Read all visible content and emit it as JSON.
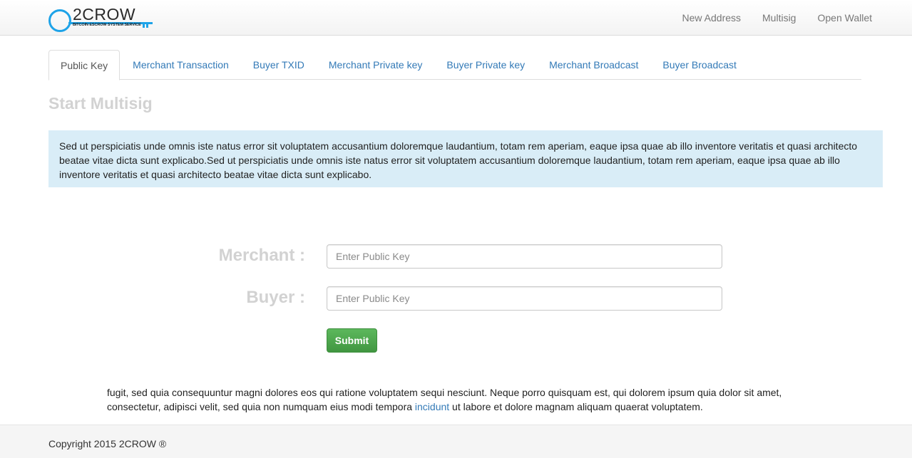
{
  "brand": {
    "name": "2CROW",
    "tagline": "BITCOIN ESCROW SYSTEM SERVICE",
    "accent_color": "#1ea3e8"
  },
  "nav": {
    "links": [
      "New Address",
      "Multisig",
      "Open Wallet"
    ]
  },
  "tabs": {
    "items": [
      "Public Key",
      "Merchant Transaction",
      "Buyer TXID",
      "Merchant Private key",
      "Buyer Private key",
      "Merchant Broadcast",
      "Buyer Broadcast"
    ],
    "active": "Public Key"
  },
  "page": {
    "title": "Start Multisig",
    "intro": "Sed ut perspiciatis unde omnis iste natus error sit voluptatem accusantium doloremque laudantium, totam rem aperiam, eaque ipsa quae ab illo inventore veritatis et quasi architecto beatae vitae dicta sunt explicabo.Sed ut perspiciatis unde omnis iste natus error sit voluptatem accusantium doloremque laudantium, totam rem aperiam, eaque ipsa quae ab illo inventore veritatis et quasi architecto beatae vitae dicta sunt explicabo."
  },
  "form": {
    "merchant_label": "Merchant :",
    "merchant_placeholder": "Enter Public Key",
    "merchant_value": "",
    "buyer_label": "Buyer :",
    "buyer_placeholder": "Enter Public Key",
    "buyer_value": "",
    "submit_label": "Submit"
  },
  "bottom": {
    "text_before": "fugit, sed quia consequuntur magni dolores eos qui ratione voluptatem sequi nesciunt. Neque porro quisquam est, qui dolorem ipsum quia dolor sit amet, consectetur, adipisci velit, sed quia non numquam eius modi tempora ",
    "link": "incidunt",
    "text_after": " ut labore et dolore magnam aliquam quaerat voluptatem."
  },
  "footer": {
    "copyright": "Copyright 2015 2CROW ®"
  }
}
